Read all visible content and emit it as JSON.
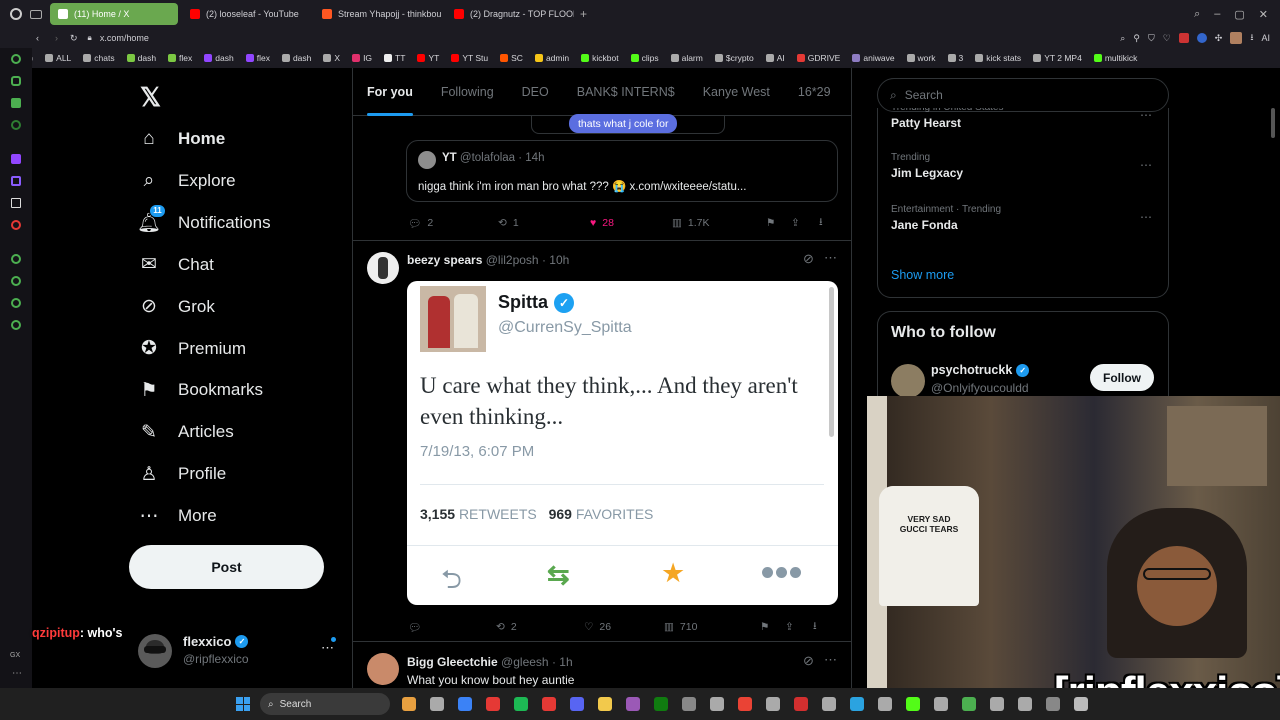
{
  "browser": {
    "tabs": [
      {
        "label": "(11) Home / X",
        "active": true,
        "color": "#ffffff"
      },
      {
        "label": "(2) looseleaf - YouTube",
        "color": "#ff0000"
      },
      {
        "label": "Stream Yhapojj - thinkbou",
        "color": "#ff5722"
      },
      {
        "label": "(2) Dragnutz - TOP FLOOR",
        "color": "#ff0000"
      }
    ],
    "url": "x.com/home",
    "bookmarks": [
      "ALL",
      "chats",
      "dash",
      "flex",
      "dash",
      "flex",
      "dash",
      "X",
      "IG",
      "TT",
      "YT",
      "YT Stu",
      "SC",
      "admin",
      "kickbot",
      "clips",
      "alarm",
      "$crypto",
      "AI",
      "GDRIVE",
      "aniwave",
      "work",
      "3",
      "kick stats",
      "YT 2 MP4",
      "multikick"
    ]
  },
  "nav": {
    "items": [
      {
        "label": "Home",
        "icon": "home-icon",
        "glyph": "⌂",
        "bold": true
      },
      {
        "label": "Explore",
        "icon": "search-icon",
        "glyph": "⌕"
      },
      {
        "label": "Notifications",
        "icon": "bell-icon",
        "glyph": "🔔︎",
        "badge": "11"
      },
      {
        "label": "Chat",
        "icon": "mail-icon",
        "glyph": "✉"
      },
      {
        "label": "Grok",
        "icon": "grok-icon",
        "glyph": "⊘"
      },
      {
        "label": "Premium",
        "icon": "verified-icon",
        "glyph": "✪"
      },
      {
        "label": "Bookmarks",
        "icon": "bookmark-icon",
        "glyph": "⚑"
      },
      {
        "label": "Articles",
        "icon": "articles-icon",
        "glyph": "✎"
      },
      {
        "label": "Profile",
        "icon": "profile-icon",
        "glyph": "♙"
      },
      {
        "label": "More",
        "icon": "more-icon",
        "glyph": "⋯"
      }
    ],
    "post_label": "Post",
    "account": {
      "name": "flexxico",
      "handle": "@ripflexxico"
    }
  },
  "chat": {
    "user": "qzipitup",
    "text": ": who's"
  },
  "feed": {
    "tabs": [
      "For you",
      "Following",
      "DEO",
      "BANK$ INTERN$",
      "Kanye West",
      "16*29"
    ],
    "quoted_bubble": "thats what j cole for",
    "quoted": {
      "name": "YT",
      "handle": "@tolafolaa",
      "time": "· 14h",
      "text": "nigga think i'm iron man bro what ??? 😭 x.com/wxiteeee/statu..."
    },
    "tweet1_stats": {
      "replies": "2",
      "reposts": "1",
      "likes": "28",
      "views": "1.7K"
    },
    "tweet2": {
      "name": "beezy spears",
      "handle": "@lil2posh",
      "time": "· 10h",
      "card": {
        "name": "Spitta",
        "handle": "@CurrenSy_Spitta",
        "text": "U care what they think,... And they aren't even thinking...",
        "date": "7/19/13, 6:07 PM",
        "retweets": "3,155",
        "retweets_label": "RETWEETS",
        "favorites": "969",
        "favorites_label": "FAVORITES"
      },
      "stats": {
        "replies": "",
        "reposts": "2",
        "likes": "26",
        "views": "710"
      }
    },
    "tweet3": {
      "name": "Bigg Gleectchie",
      "handle": "@gleesh",
      "time": "· 1h",
      "text": "What you know bout hey auntie"
    }
  },
  "right": {
    "search_placeholder": "Search",
    "trends": [
      {
        "category": "Trending in United States",
        "name": "Patty Hearst"
      },
      {
        "category": "Trending",
        "name": "Jim Legxacy"
      },
      {
        "category": "Entertainment · Trending",
        "name": "Jane Fonda"
      }
    ],
    "show_more": "Show more",
    "who_to_follow": "Who to follow",
    "follow_suggestion": {
      "name": "psychotruckk",
      "handle": "@Onlyifyoucouldd",
      "button": "Follow"
    }
  },
  "overlay": {
    "streamer_tag": "[ripflexxico]",
    "shirt_text": "VERY SAD GUCCI TEARS"
  },
  "taskbar": {
    "search_label": "Search"
  },
  "colors": {
    "accent": "#1d9bf0",
    "like": "#f91880",
    "bg": "#000000",
    "border": "#2f3336",
    "retweet_green": "#5aa84f",
    "star": "#f5a623"
  }
}
